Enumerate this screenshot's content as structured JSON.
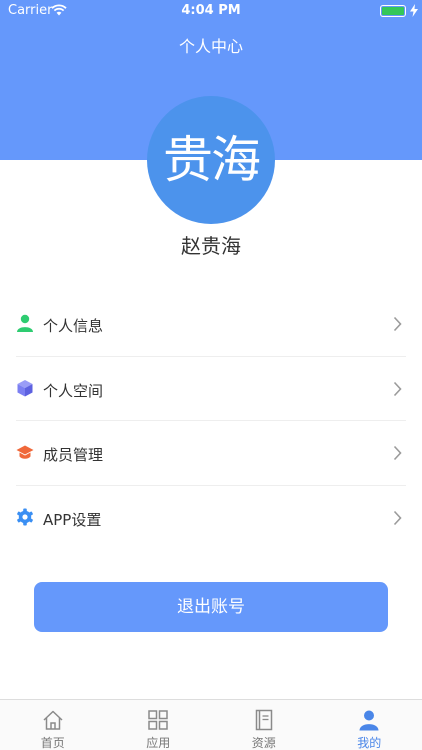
{
  "status_bar": {
    "carrier": "Carrier",
    "time": "4:04 PM"
  },
  "header": {
    "title": "个人中心"
  },
  "profile": {
    "avatar_text": "贵海",
    "name": "赵贵海"
  },
  "menu": [
    {
      "label": "个人信息",
      "icon": "user-icon",
      "color": "#2ecc71"
    },
    {
      "label": "个人空间",
      "icon": "cube-icon",
      "color": "#7b7ff2"
    },
    {
      "label": "成员管理",
      "icon": "graduation-cap-icon",
      "color": "#f0683a"
    },
    {
      "label": "APP设置",
      "icon": "gear-icon",
      "color": "#3b8ff3"
    }
  ],
  "logout": {
    "label": "退出账号"
  },
  "tabs": [
    {
      "label": "首页",
      "icon": "home-icon",
      "active": false
    },
    {
      "label": "应用",
      "icon": "grid-icon",
      "active": false
    },
    {
      "label": "资源",
      "icon": "book-icon",
      "active": false
    },
    {
      "label": "我的",
      "icon": "profile-icon",
      "active": true
    }
  ],
  "colors": {
    "primary": "#6598fb",
    "avatar": "#4c93ec",
    "active_tab": "#4a86e8"
  }
}
